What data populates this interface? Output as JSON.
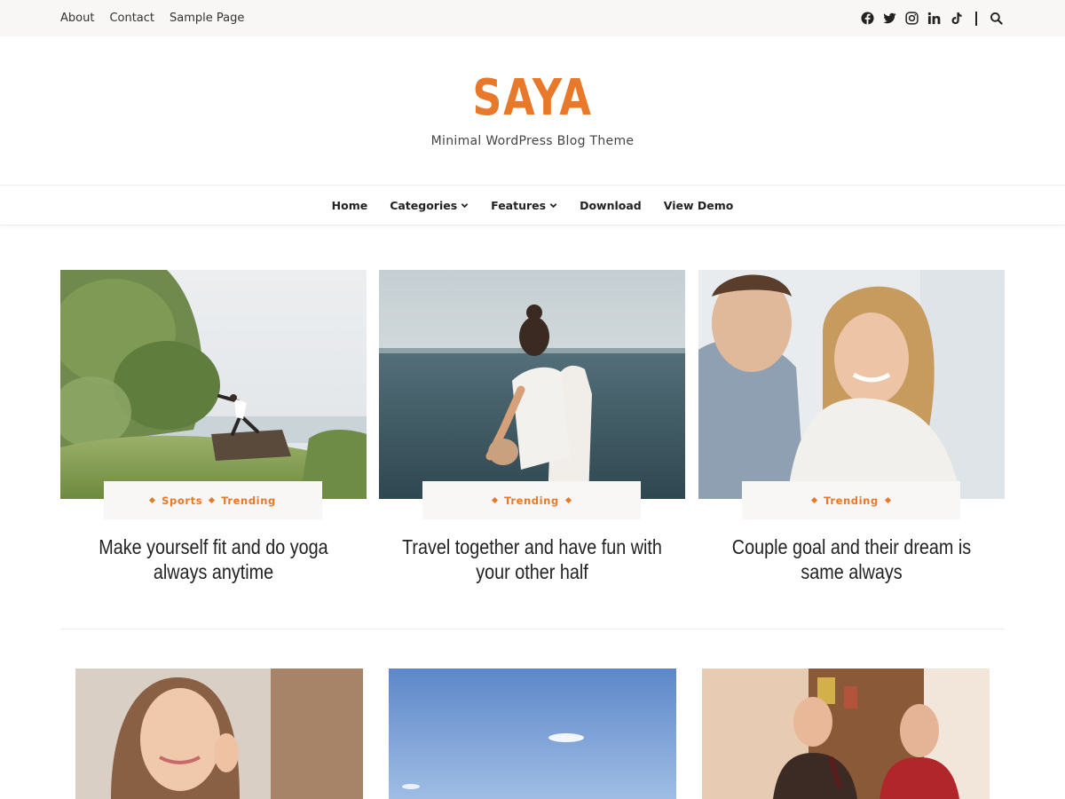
{
  "topbar": {
    "links": [
      "About",
      "Contact",
      "Sample Page"
    ],
    "social_icons": [
      "facebook-icon",
      "twitter-icon",
      "instagram-icon",
      "linkedin-icon",
      "tiktok-icon"
    ],
    "search_icon": "search-icon"
  },
  "site": {
    "title": "SAYA",
    "tagline": "Minimal WordPress Blog Theme",
    "accent_color": "#e8792b"
  },
  "nav": {
    "items": [
      {
        "label": "Home",
        "dropdown": false
      },
      {
        "label": "Categories",
        "dropdown": true
      },
      {
        "label": "Features",
        "dropdown": true
      },
      {
        "label": "Download",
        "dropdown": false
      },
      {
        "label": "View Demo",
        "dropdown": false
      }
    ]
  },
  "posts": [
    {
      "categories": [
        "Sports",
        "Trending"
      ],
      "title": "Make yourself fit and do yoga always anytime"
    },
    {
      "categories": [
        "Trending"
      ],
      "title": "Travel together and have fun with your other half"
    },
    {
      "categories": [
        "Trending"
      ],
      "title": "Couple goal and their dream is same always"
    }
  ]
}
